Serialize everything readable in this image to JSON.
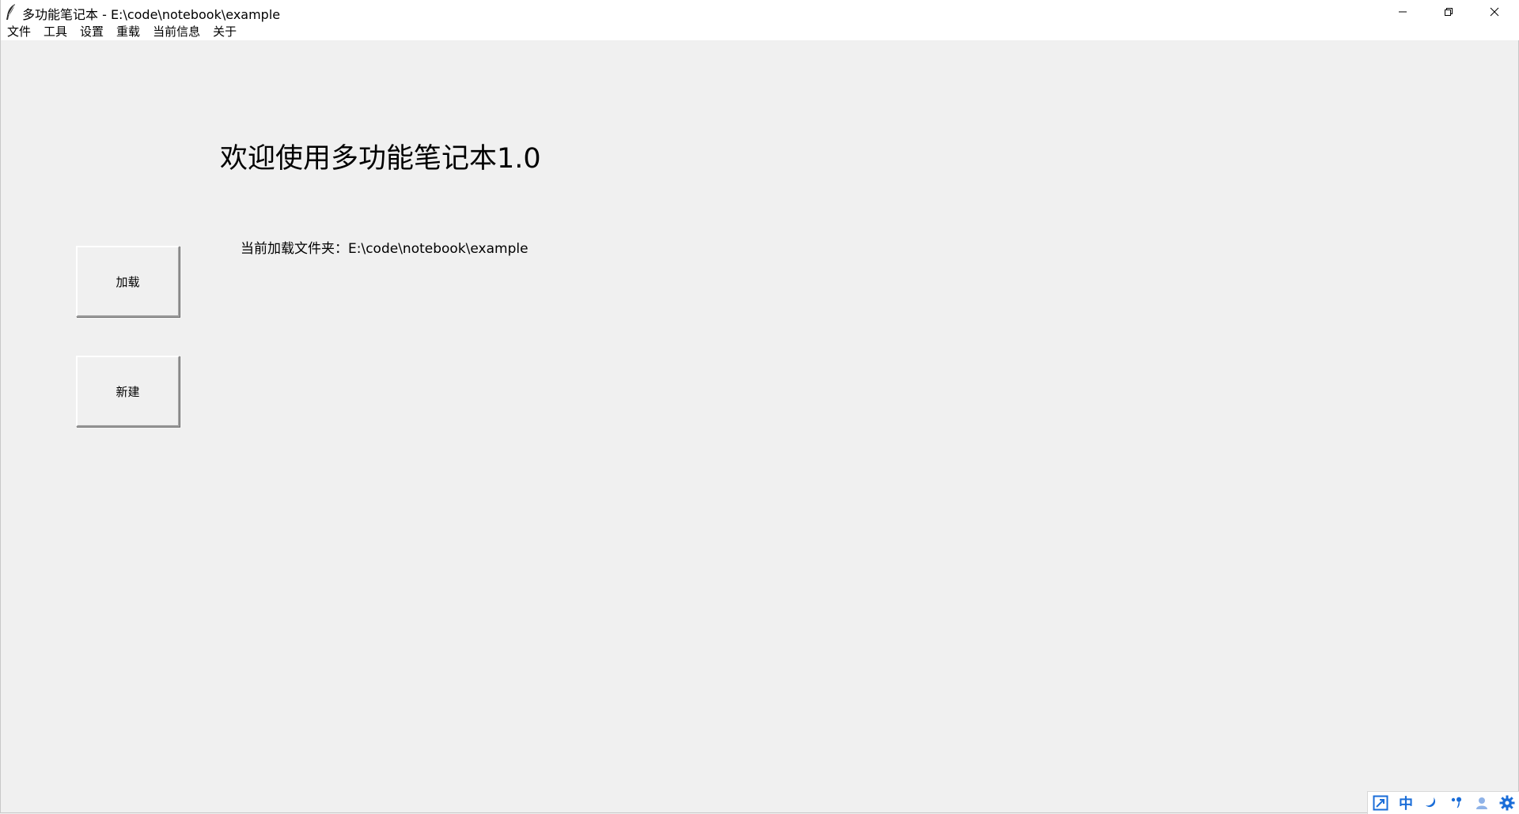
{
  "window": {
    "title": "多功能笔记本 - E:\\code\\notebook\\example"
  },
  "menu": {
    "items": [
      "文件",
      "工具",
      "设置",
      "重载",
      "当前信息",
      "关于"
    ]
  },
  "main": {
    "heading": "欢迎使用多功能笔记本1.0",
    "folder_line": "当前加载文件夹：E:\\code\\notebook\\example",
    "load_button": "加载",
    "new_button": "新建"
  },
  "tray": {
    "ime_mode": "中",
    "icons": [
      "ime-toggle-icon",
      "chinese-mode-icon",
      "moon-icon",
      "punctuation-icon",
      "user-icon",
      "gear-icon"
    ]
  },
  "colors": {
    "window_bg": "#f0f0f0",
    "titlebar_bg": "#ffffff",
    "tray_accent": "#1a6dd8"
  }
}
